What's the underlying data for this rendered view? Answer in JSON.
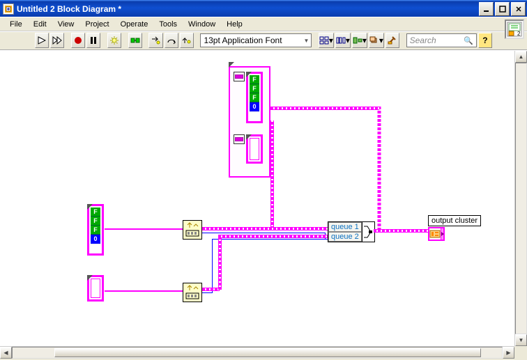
{
  "window": {
    "title": "Untitled 2 Block Diagram *"
  },
  "menu": {
    "file": "File",
    "edit": "Edit",
    "view": "View",
    "project": "Project",
    "operate": "Operate",
    "tools": "Tools",
    "window": "Window",
    "help": "Help"
  },
  "toolbar": {
    "font": "13pt Application Font",
    "search_placeholder": "Search"
  },
  "diagram": {
    "bool_f": "F",
    "num_zero": "0",
    "queue1": "queue 1",
    "queue2": "queue 2",
    "output": "output cluster"
  },
  "icon_panel": {
    "label": "2"
  }
}
